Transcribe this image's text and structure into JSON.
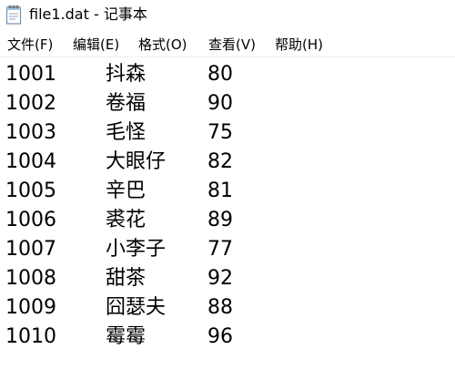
{
  "window": {
    "title": "file1.dat - 记事本"
  },
  "icons": {
    "app": "notepad-icon"
  },
  "menu": [
    {
      "label": "文件(F)"
    },
    {
      "label": "编辑(E)"
    },
    {
      "label": "格式(O)"
    },
    {
      "label": "查看(V)"
    },
    {
      "label": "帮助(H)"
    }
  ],
  "rows": [
    {
      "id": "1001",
      "name": "抖森",
      "score": "80"
    },
    {
      "id": "1002",
      "name": "卷福",
      "score": "90"
    },
    {
      "id": "1003",
      "name": "毛怪",
      "score": "75"
    },
    {
      "id": "1004",
      "name": "大眼仔",
      "score": "82"
    },
    {
      "id": "1005",
      "name": "辛巴",
      "score": "81"
    },
    {
      "id": "1006",
      "name": "裘花",
      "score": "89"
    },
    {
      "id": "1007",
      "name": "小李子",
      "score": "77"
    },
    {
      "id": "1008",
      "name": "甜茶",
      "score": "92"
    },
    {
      "id": "1009",
      "name": "囧瑟夫",
      "score": "88"
    },
    {
      "id": "1010",
      "name": "霉霉",
      "score": "96"
    }
  ]
}
